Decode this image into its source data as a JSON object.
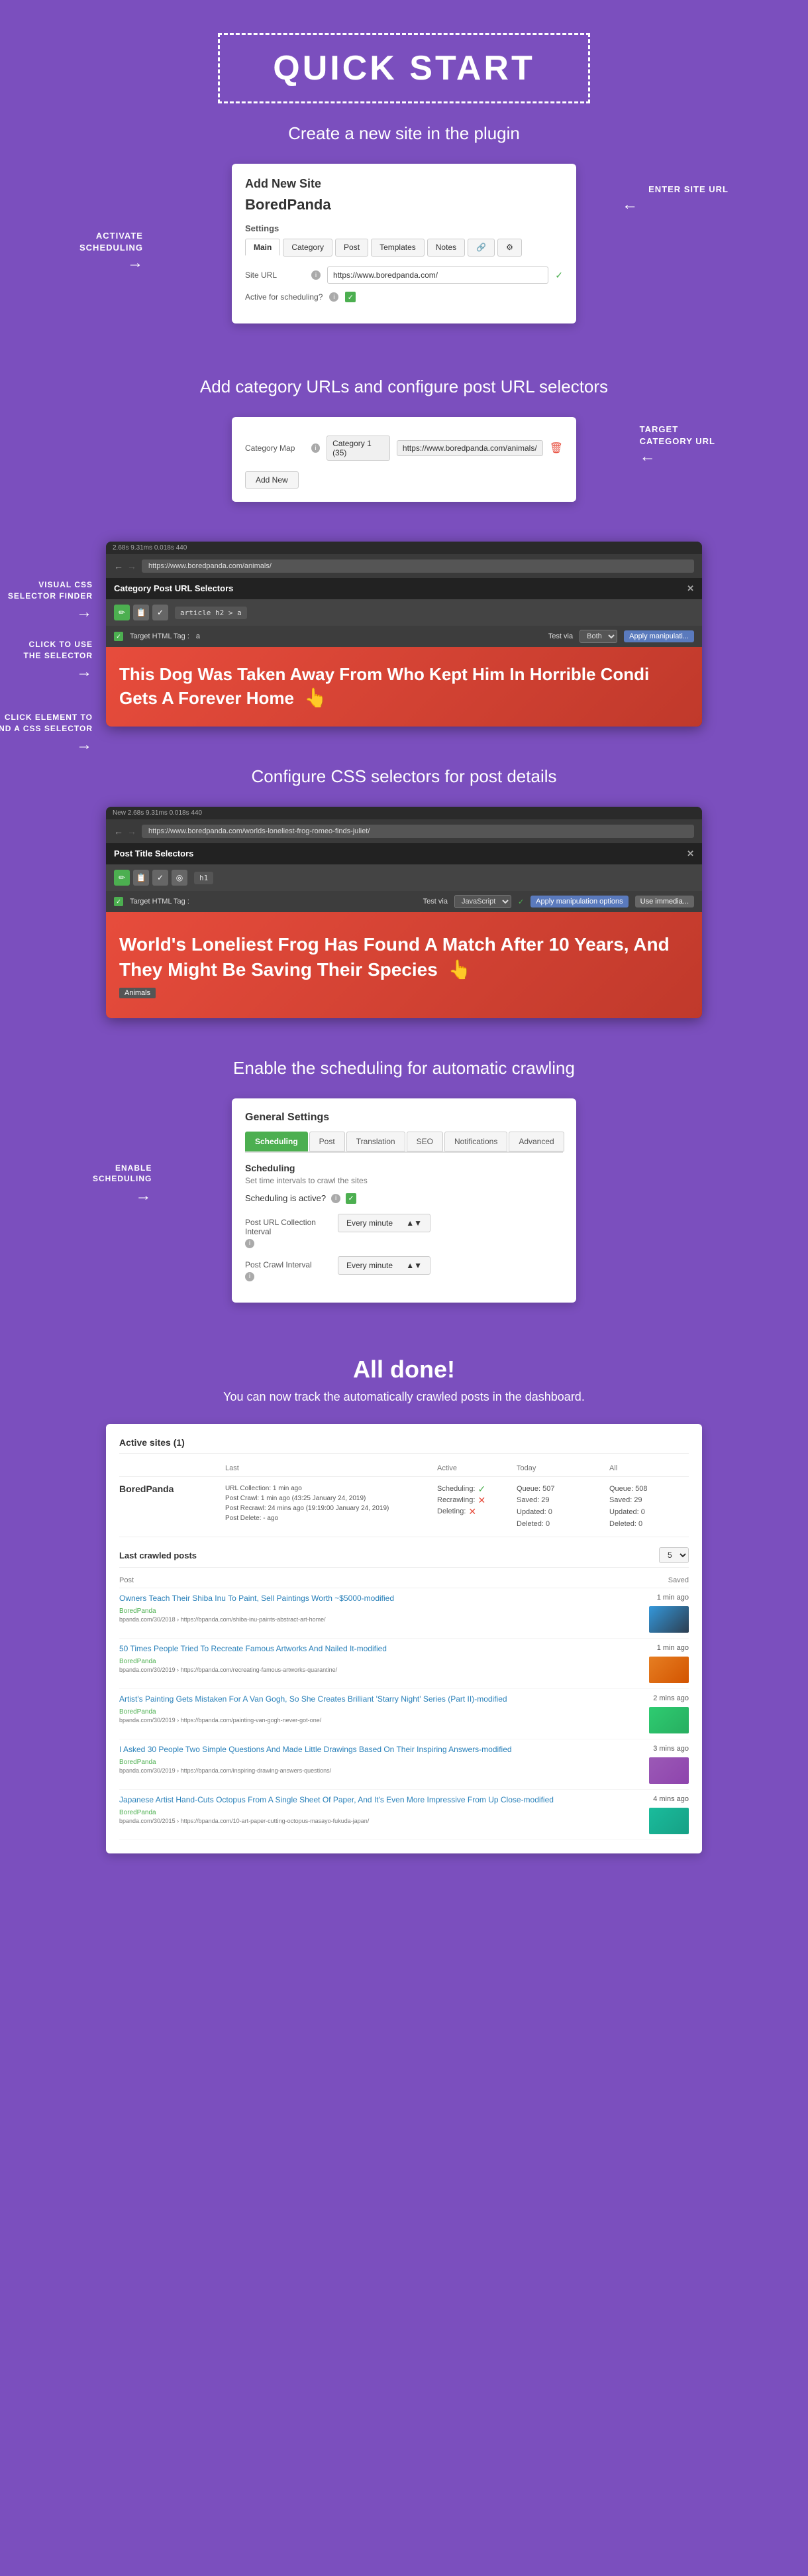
{
  "quick_start": {
    "title": "QUICK START",
    "step1": {
      "subtitle": "Create a new site in the plugin",
      "card": {
        "title": "Add New Site",
        "site_name": "BoredPanda",
        "settings_label": "Settings",
        "tabs": [
          "Main",
          "Category",
          "Post",
          "Templates",
          "Notes"
        ],
        "site_url_label": "Site URL",
        "site_url_value": "https://www.boredpanda.com/",
        "active_label": "Active for scheduling?",
        "active_checked": true
      },
      "annotation1": "ENTER SITE URL",
      "annotation2": "ACTIVATE\nSCHEDULING"
    },
    "step2": {
      "subtitle": "Add category URLs and configure post URL selectors",
      "card": {
        "category_label": "Category Map",
        "category_tag": "Category 1 (35)",
        "category_url": "https://www.boredpanda.com/animals/",
        "add_new": "Add New"
      },
      "annotation1": "TARGET\nCATEGORY URL"
    },
    "step3": {
      "browser1": {
        "url": "https://www.boredpanda.com/animals/",
        "title": "Category Post URL Selectors",
        "selector_code": "article h2 > a",
        "target_html_tag_label": "Target HTML Tag :",
        "target_html_tag_value": "a",
        "test_via_label": "Test via",
        "test_via_value": "Both",
        "apply_manipulation": "Apply manipulati...",
        "article_title": "This Dog Was Taken Away From Who Kept Him In Horrible Condi Gets A Forever Home",
        "stats": "2.68s  9.31ms  0.018s  440"
      },
      "annotations": {
        "visual_css": "VISUAL CSS\nSELECTOR FINDER",
        "click_to_use": "CLICK TO USE\nTHE SELECTOR",
        "click_element": "CLICK ELEMENT TO\nFIND A CSS SELECTOR"
      }
    },
    "step4": {
      "subtitle": "Configure CSS selectors for post details",
      "browser2": {
        "url": "https://www.boredpanda.com/worlds-loneliest-frog-romeo-finds-juliet/",
        "title": "Post Title Selectors",
        "selector_code": "h1",
        "target_html_tag_label": "Target HTML Tag :",
        "test_via_label": "Test via",
        "test_via_value": "JavaScript",
        "apply_manipulation": "Apply manipulation options",
        "use_immed": "Use immedia...",
        "article_title": "World's Loneliest Frog Has Found A Match After 10 Years, And They Might Be Saving Their Species",
        "article_tag": "Animals",
        "stats": "New  2.68s  9.31ms  0.018s  440"
      }
    },
    "step5": {
      "subtitle": "Enable the scheduling for automatic crawling",
      "card": {
        "title": "General Settings",
        "tabs": [
          "Scheduling",
          "Post",
          "Translation",
          "SEO",
          "Notifications",
          "Advanced"
        ],
        "active_tab": "Scheduling",
        "scheduling_title": "Scheduling",
        "scheduling_desc": "Set time intervals to crawl the sites",
        "is_active_label": "Scheduling is active?",
        "interval1_label": "Post URL Collection\nInterval",
        "interval1_value": "Every minute",
        "interval2_label": "Post Crawl Interval",
        "interval2_value": "Every minute"
      },
      "annotation": "ENABLE\nSCHEDULING"
    },
    "step6": {
      "title": "All done!",
      "subtitle": "You can now track the automatically crawled posts in the dashboard.",
      "dashboard": {
        "active_sites_title": "Active sites (1)",
        "columns": [
          "",
          "Last",
          "",
          "Active",
          "Today",
          "All"
        ],
        "site": {
          "name": "BoredPanda",
          "last_details": [
            "URL Collection: 1 min ago",
            "Post Crawl: 1 min ago   (43:25 January 24, 2019)",
            "Post Recrawl: 24 mins ago   (19:19:00 January 24, 2019)",
            "Post Delete: - ago"
          ],
          "active": {
            "scheduling": "Scheduling:",
            "recrawling": "Recrawling:",
            "deleting": "Deleting:",
            "scheduling_status": "check",
            "recrawling_status": "x",
            "deleting_status": "x"
          },
          "today": {
            "queue": "Queue: 507",
            "saved": "Saved: 29",
            "updated": "Updated: 0",
            "deleted": "Deleted: 0"
          },
          "all": {
            "queue": "Queue: 508",
            "saved": "Saved: 29",
            "updated": "Updated: 0",
            "deleted": "Deleted: 0"
          }
        },
        "last_crawled_title": "Last crawled posts",
        "count": "5",
        "post_columns": [
          "Post",
          "Saved"
        ],
        "posts": [
          {
            "title": "Owners Teach Their Shiba Inu To Paint, Sell Paintings Worth ~$5000-modified",
            "site": "BoredPanda",
            "url": "bpanda.com/30/2018 › https://bpanda.com/shiba-inu-paints-abstract-art-home/",
            "saved": "1 min ago"
          },
          {
            "title": "50 Times People Tried To Recreate Famous Artworks And Nailed It-modified",
            "site": "BoredPanda",
            "url": "bpanda.com/30/2019 › https://bpanda.com/recreating-famous-artworks-quarantine/",
            "saved": "1 min ago"
          },
          {
            "title": "Artist's Painting Gets Mistaken For A Van Gogh, So She Creates Brilliant 'Starry Night' Series (Part II)-modified",
            "site": "BoredPanda",
            "url": "bpanda.com/30/2019 › https://bpanda.com/painting-van-gogh-never-got-one/",
            "saved": "2 mins ago"
          },
          {
            "title": "I Asked 30 People Two Simple Questions And Made Little Drawings Based On Their Inspiring Answers-modified",
            "site": "BoredPanda",
            "url": "bpanda.com/30/2019 › https://bpanda.com/inspiring-drawing-answers-questions/",
            "saved": "3 mins ago"
          },
          {
            "title": "Japanese Artist Hand-Cuts Octopus From A Single Sheet Of Paper, And It's Even More Impressive From Up Close-modified",
            "site": "BoredPanda",
            "url": "bpanda.com/30/2015 › https://bpanda.com/10-art-paper-cutting-octopus-masayo-fukuda-japan/",
            "saved": "4 mins ago"
          }
        ]
      }
    }
  }
}
